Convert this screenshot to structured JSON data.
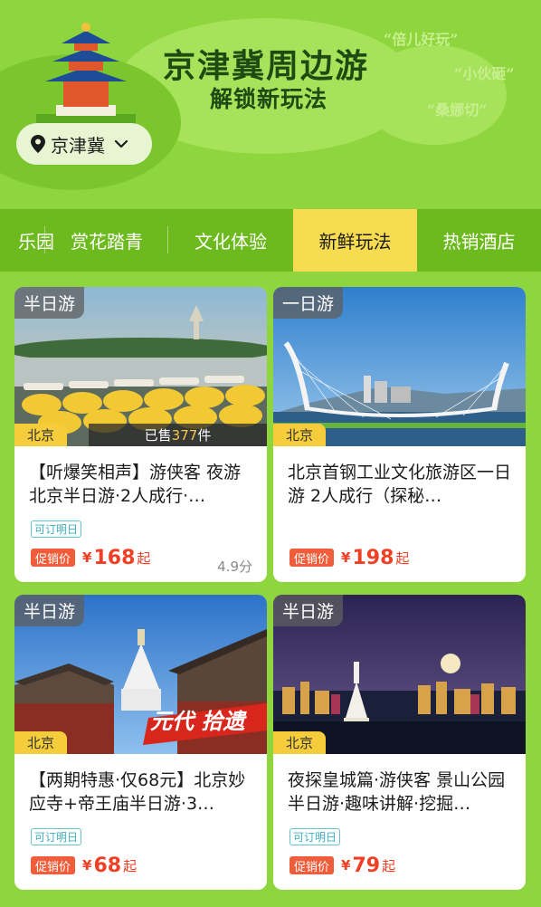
{
  "banner": {
    "title": "京津冀周边游",
    "subtitle": "解锁新玩法",
    "bg_quotes": [
      "“倍儿好玩”",
      "“小伙砸”",
      "“桑娜切”"
    ]
  },
  "location": {
    "label": "京津冀"
  },
  "tabs": [
    {
      "label": "乐园",
      "active": false
    },
    {
      "label": "赏花踏青",
      "active": false
    },
    {
      "label": "文化体验",
      "active": false
    },
    {
      "label": "新鲜玩法",
      "active": true
    },
    {
      "label": "热销酒店",
      "active": false
    }
  ],
  "cards": [
    {
      "type": "半日游",
      "city": "北京",
      "sold_prefix": "已售",
      "sold_count": "377",
      "sold_suffix": "件",
      "title": "【听爆笑相声】游侠客 夜游北京半日游·2人成行·…",
      "book_badge": "可订明日",
      "promo": "促销价",
      "currency": "¥",
      "price": "168",
      "price_suffix": "起",
      "score": "4.9分"
    },
    {
      "type": "一日游",
      "city": "北京",
      "title": "北京首钢工业文化旅游区一日游 2人成行（探秘…",
      "promo": "促销价",
      "currency": "¥",
      "price": "198",
      "price_suffix": "起"
    },
    {
      "type": "半日游",
      "city": "北京",
      "image_caption": "元代 拾遗",
      "title": "【两期特惠·仅68元】北京妙应寺+帝王庙半日游·3…",
      "book_badge": "可订明日",
      "promo": "促销价",
      "currency": "¥",
      "price": "68",
      "price_suffix": "起"
    },
    {
      "type": "半日游",
      "city": "北京",
      "title": "夜探皇城篇·游侠客 景山公园半日游·趣味讲解·挖掘…",
      "book_badge": "可订明日",
      "promo": "促销价",
      "currency": "¥",
      "price": "79",
      "price_suffix": "起"
    }
  ],
  "colors": {
    "page_bg": "#8fd63e",
    "tab_bar": "#6cba1e",
    "tab_active": "#f7dc52",
    "price": "#f03f24",
    "city_badge": "#f5cd3c"
  }
}
